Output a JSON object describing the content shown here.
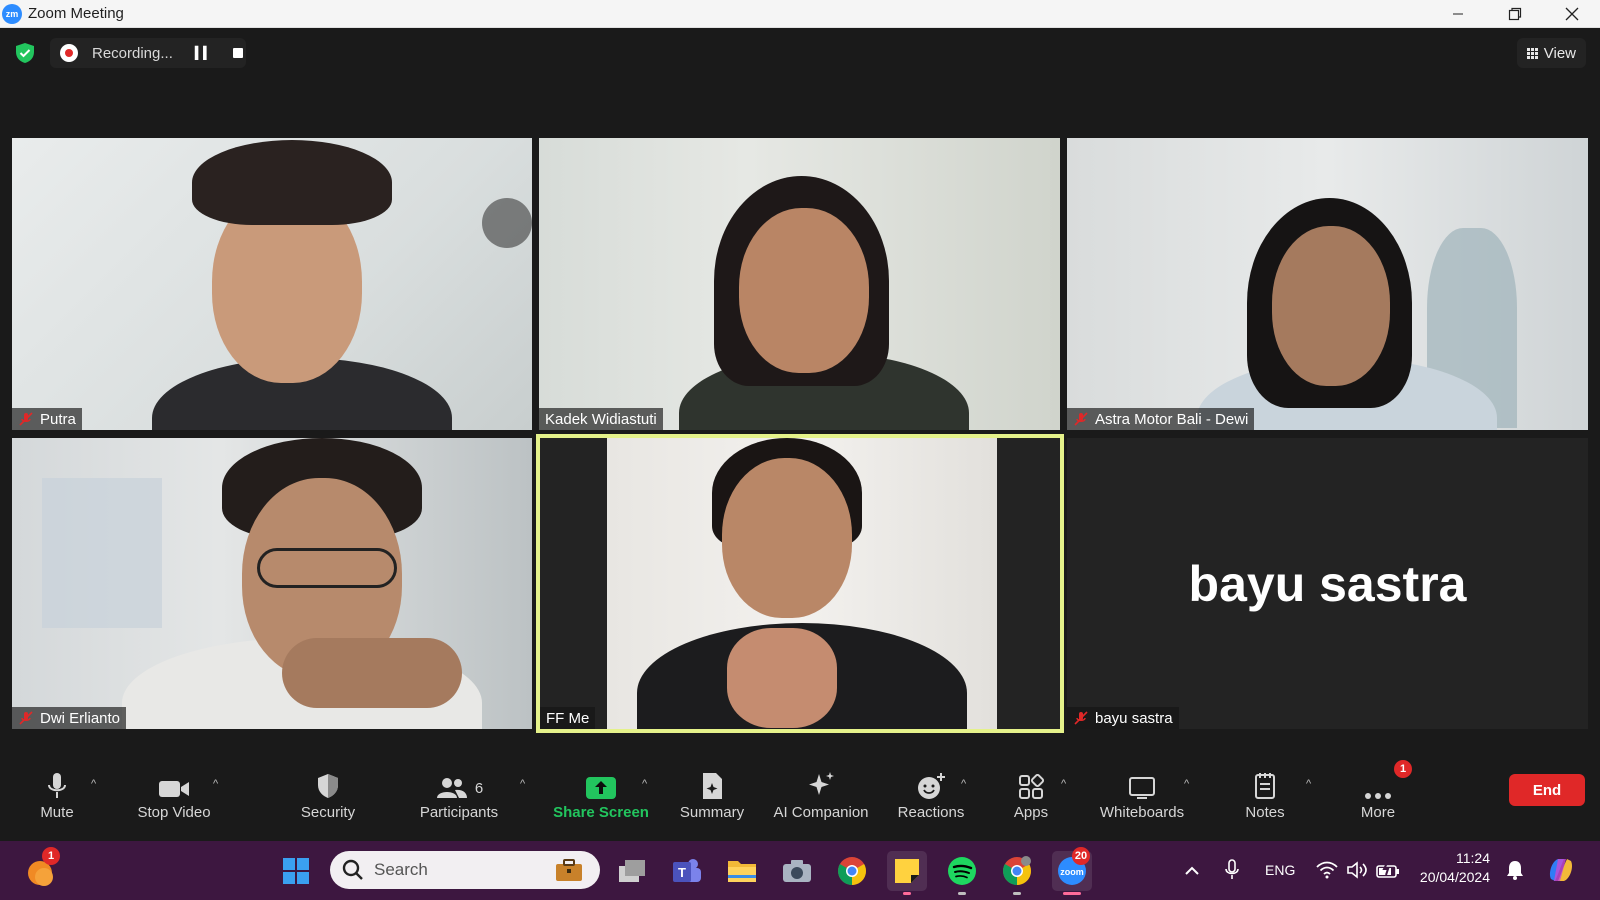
{
  "window": {
    "app_logo": "zm",
    "title": "Zoom Meeting"
  },
  "topbar": {
    "recording_text": "Recording...",
    "view_label": "View"
  },
  "participants": [
    {
      "name": "Putra",
      "muted": true
    },
    {
      "name": "Kadek Widiastuti",
      "muted": false
    },
    {
      "name": "Astra Motor Bali - Dewi",
      "muted": true
    },
    {
      "name": "Dwi Erlianto",
      "muted": true
    },
    {
      "name": "FF Me",
      "muted": false,
      "active_speaker": true
    },
    {
      "name": "bayu sastra",
      "muted": true,
      "video_off": true,
      "display_name": "bayu sastra"
    }
  ],
  "toolbar": {
    "mute": "Mute",
    "stop_video": "Stop Video",
    "security": "Security",
    "participants": "Participants",
    "participants_count": "6",
    "share_screen": "Share Screen",
    "summary": "Summary",
    "ai_companion": "AI Companion",
    "reactions": "Reactions",
    "apps": "Apps",
    "whiteboards": "Whiteboards",
    "notes": "Notes",
    "more": "More",
    "more_badge": "1",
    "end": "End"
  },
  "taskbar": {
    "weather_badge": "1",
    "search_placeholder": "Search",
    "zoom_badge": "20",
    "language": "ENG",
    "time": "11:24",
    "date": "20/04/2024"
  },
  "colors": {
    "accent_share": "#22c55e",
    "end_red": "#e02828",
    "speaker_border": "#e5f28a",
    "taskbar_bg": "#3d1740"
  }
}
